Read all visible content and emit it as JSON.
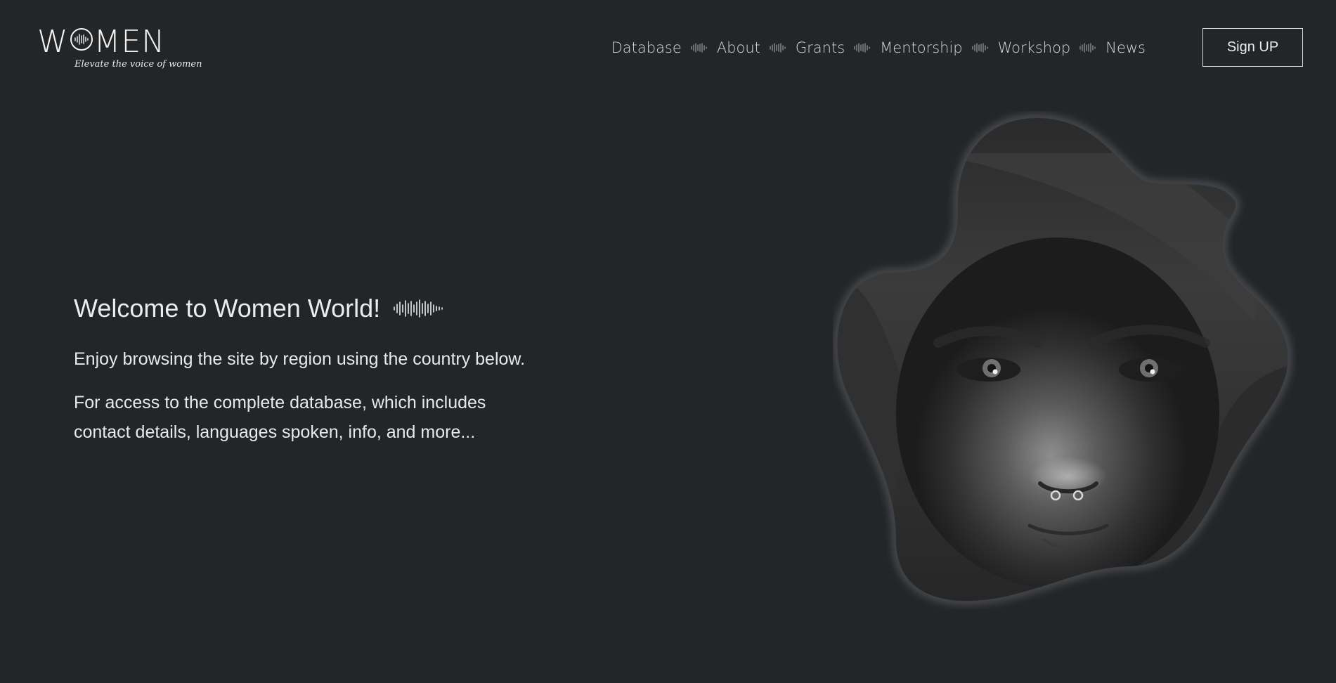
{
  "header": {
    "logo_word_left": "W",
    "logo_word_right": "MEN",
    "logo_tagline": "Elevate the voice of women",
    "nav": [
      {
        "label": "Database"
      },
      {
        "label": "About"
      },
      {
        "label": "Grants"
      },
      {
        "label": "Mentorship"
      },
      {
        "label": "Workshop"
      },
      {
        "label": "News"
      }
    ],
    "signup_label": "Sign UP"
  },
  "hero": {
    "title": "Welcome to Women World!",
    "paragraph_1": "Enjoy browsing the site by region using the country below.",
    "paragraph_2": "For access to the complete database, which includes contact details, languages spoken, info, and more..."
  },
  "icons": {
    "logo_o": "soundwave-icon",
    "nav_separator": "soundwave-icon",
    "title_wave": "soundwave-icon"
  },
  "colors": {
    "background": "#232527",
    "text": "#e9edf0",
    "nav_text": "#d4d7da",
    "separator": "#8c949c"
  }
}
